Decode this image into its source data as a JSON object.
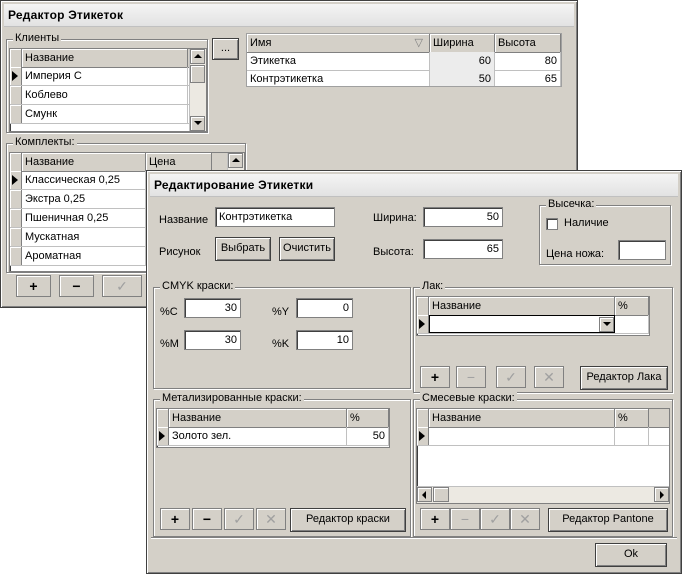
{
  "main_window": {
    "title": "Редактор Этикеток",
    "clients": {
      "label": "Клиенты",
      "header": "Название",
      "rows": [
        "Империя С",
        "Коблево",
        "Смунк"
      ],
      "ellipsis_label": "..."
    },
    "labels_table": {
      "columns": [
        "Имя",
        "Ширина",
        "Высота"
      ],
      "rows": [
        {
          "name": "Этикетка",
          "width": "60",
          "height": "80"
        },
        {
          "name": "Контрэтикетка",
          "width": "50",
          "height": "65"
        }
      ]
    },
    "sets": {
      "label": "Комплекты:",
      "columns": [
        "Название",
        "Цена"
      ],
      "rows": [
        "Классическая 0,25",
        "Экстра 0,25",
        "Пшеничная 0,25",
        "Мускатная",
        "Ароматная"
      ]
    },
    "toolbar": {
      "add": "+",
      "remove": "−",
      "ok": "✓"
    }
  },
  "edit_window": {
    "title": "Редактирование Этикетки",
    "name_label": "Название",
    "name_value": "Контрэтикетка",
    "picture_label": "Рисунок",
    "choose_button": "Выбрать",
    "clear_button": "Очистить",
    "width_label": "Ширина:",
    "width_value": "50",
    "height_label": "Высота:",
    "height_value": "65",
    "die_cut": {
      "label": "Высечка:",
      "presence_label": "Наличие",
      "knife_price_label": "Цена ножа:",
      "knife_price_value": ""
    },
    "cmyk": {
      "label": "CMYK краски:",
      "c_label": "%C",
      "c_value": "30",
      "m_label": "%M",
      "m_value": "30",
      "y_label": "%Y",
      "y_value": "0",
      "k_label": "%K",
      "k_value": "10"
    },
    "varnish": {
      "label": "Лак:",
      "columns": [
        "Название",
        "%"
      ],
      "editor_button": "Редактор Лака"
    },
    "metallic": {
      "label": "Метализированные краски:",
      "columns": [
        "Название",
        "%"
      ],
      "rows": [
        {
          "name": "Золото зел.",
          "percent": "50"
        }
      ],
      "editor_button": "Редактор краски"
    },
    "mixed": {
      "label": "Смесевые краски:",
      "columns": [
        "Название",
        "%"
      ],
      "editor_button": "Редактор Pantone"
    },
    "toolbar": {
      "add": "+",
      "remove": "−",
      "ok": "✓",
      "cancel": "✕"
    },
    "ok_button": "Ok"
  }
}
